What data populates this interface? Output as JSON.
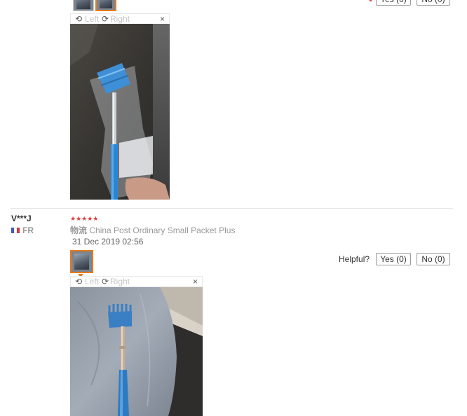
{
  "review1": {
    "toolbar": {
      "left_label": "Left",
      "right_label": "Right",
      "close_glyph": "×"
    },
    "buttons": {
      "yes_label": "Yes (0)",
      "no_label": "No (0)"
    }
  },
  "review2": {
    "username": "V***J",
    "country_code": "FR",
    "stars": "★★★★★",
    "shipping_prefix": "物流",
    "shipping_method": "China Post Ordinary Small Packet Plus",
    "date": "31 Dec 2019 02:56",
    "helpful_label": "Helpful?",
    "yes_label": "Yes (0)",
    "no_label": "No (0)",
    "toolbar": {
      "left_label": "Left",
      "right_label": "Right",
      "close_glyph": "×"
    }
  },
  "icons": {
    "rotate_left": "rotate-left-icon",
    "rotate_right": "rotate-right-icon",
    "close": "close-icon",
    "flag": "france-flag-icon"
  },
  "colors": {
    "accent": "#e87a18",
    "star": "#e4393c",
    "link_gray": "#c4c4c4"
  }
}
